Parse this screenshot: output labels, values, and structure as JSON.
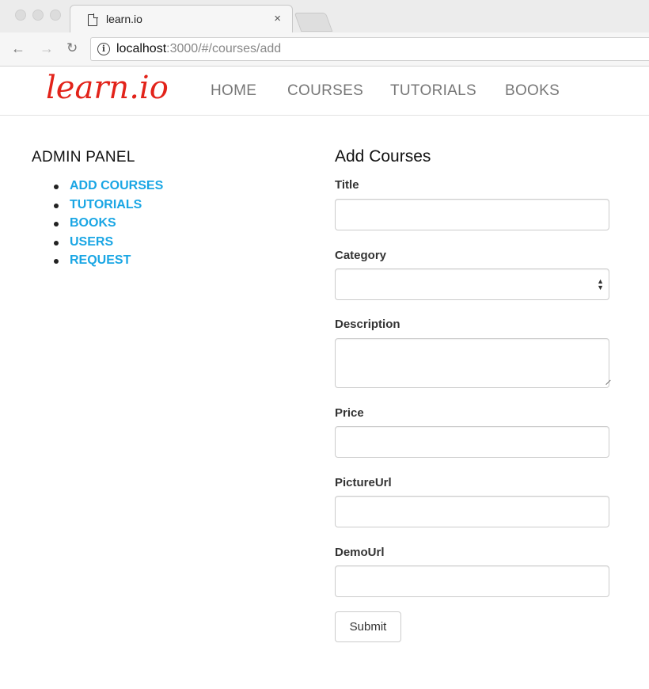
{
  "browser": {
    "tab_title": "learn.io",
    "tab_close": "×",
    "url_host": "localhost",
    "url_rest": ":3000/#/courses/add"
  },
  "site": {
    "logo": "learn.io",
    "nav": [
      "HOME",
      "COURSES",
      "TUTORIALS",
      "BOOKS"
    ],
    "logo_color": "#e2231a",
    "link_color": "#1aa6e4"
  },
  "admin": {
    "title": "ADMIN PANEL",
    "items": [
      "ADD COURSES",
      "TUTORIALS",
      "BOOKS",
      "USERS",
      "REQUEST"
    ]
  },
  "form": {
    "title": "Add Courses",
    "fields": [
      {
        "label": "Title",
        "value": ""
      },
      {
        "label": "Category",
        "value": ""
      },
      {
        "label": "Description",
        "value": ""
      },
      {
        "label": "Price",
        "value": ""
      },
      {
        "label": "PictureUrl",
        "value": ""
      },
      {
        "label": "DemoUrl",
        "value": ""
      }
    ],
    "submit": "Submit"
  }
}
